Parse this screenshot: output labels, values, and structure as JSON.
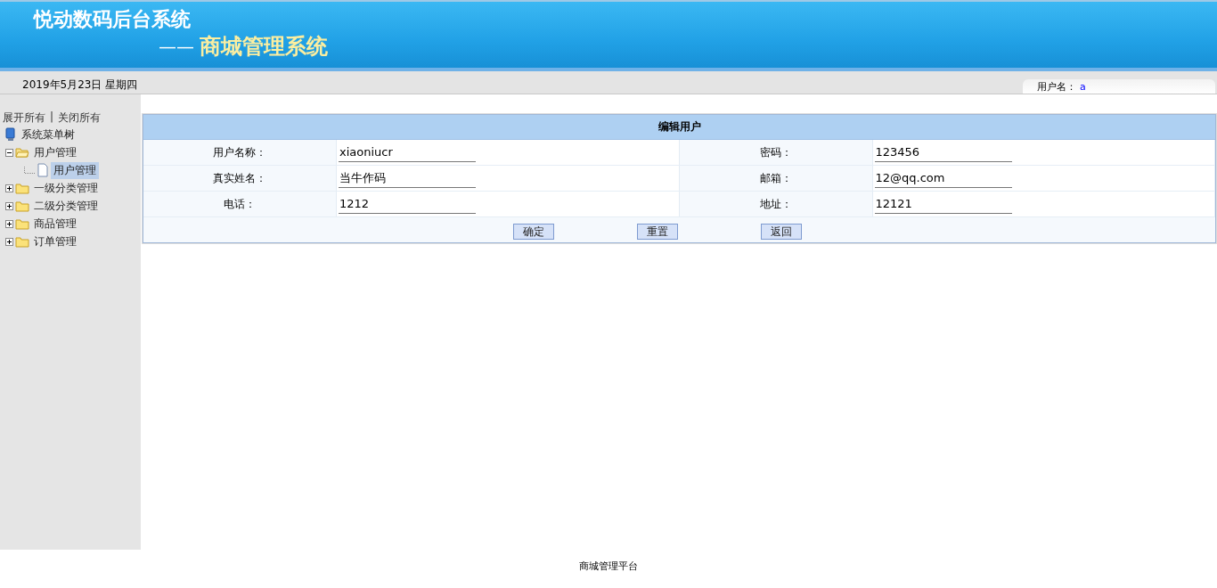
{
  "header": {
    "title": "悦动数码后台系统",
    "subtitle_dash": "——",
    "subtitle": "商城管理系统"
  },
  "info_bar": {
    "date": "2019年5月23日 星期四",
    "user_label": "用户名：",
    "user_name": "a"
  },
  "sidebar": {
    "expand_all": "展开所有",
    "separator": "|",
    "collapse_all": "关闭所有",
    "tree": {
      "label": "系统菜单树",
      "children": [
        {
          "label": "用户管理",
          "expanded": true,
          "selected": false,
          "children": [
            {
              "label": "用户管理",
              "selected": true
            }
          ]
        },
        {
          "label": "一级分类管理",
          "expanded": false,
          "selected": false
        },
        {
          "label": "二级分类管理",
          "expanded": false,
          "selected": false
        },
        {
          "label": "商品管理",
          "expanded": false,
          "selected": false
        },
        {
          "label": "订单管理",
          "expanded": false,
          "selected": false
        }
      ]
    }
  },
  "form": {
    "title": "编辑用户",
    "rows": [
      [
        {
          "label": "用户名称：",
          "value": "xiaoniucr"
        },
        {
          "label": "密码：",
          "value": "123456"
        }
      ],
      [
        {
          "label": "真实姓名：",
          "value": "当牛作码"
        },
        {
          "label": "邮箱：",
          "value": "12@qq.com"
        }
      ],
      [
        {
          "label": "电话：",
          "value": "1212"
        },
        {
          "label": "地址：",
          "value": "12121"
        }
      ]
    ],
    "buttons": [
      "确定",
      "重置",
      "返回"
    ]
  },
  "footer": "商城管理平台"
}
